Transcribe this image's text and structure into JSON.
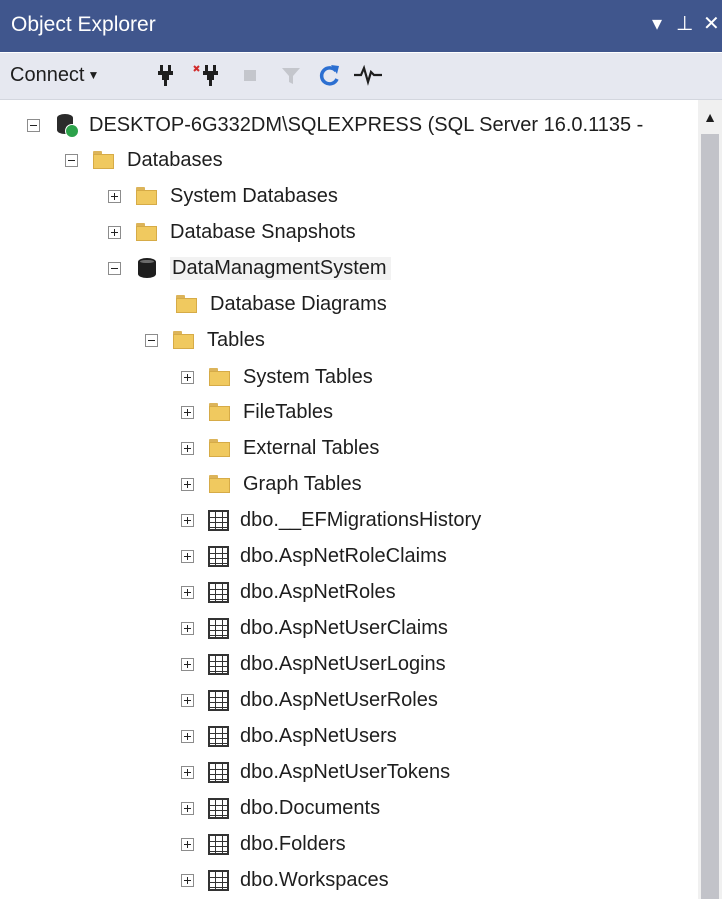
{
  "window": {
    "title": "Object Explorer",
    "controls": {
      "dropdown": "▾",
      "pin": "⊥",
      "close": "✕"
    },
    "colors": {
      "title_bar": "#40568d",
      "toolbar": "#e6e8f0"
    }
  },
  "toolbar": {
    "connect_label": "Connect",
    "icons": [
      "connect-object-explorer-icon",
      "disconnect-icon",
      "stop-icon",
      "filter-icon",
      "refresh-icon",
      "activity-monitor-icon"
    ]
  },
  "tree": {
    "server": {
      "label": "DESKTOP-6G332DM\\SQLEXPRESS (SQL Server 16.0.1135 -"
    },
    "databases": {
      "label": "Databases"
    },
    "system_databases": {
      "label": "System Databases"
    },
    "database_snapshots": {
      "label": "Database Snapshots"
    },
    "database": {
      "label": "DataManagmentSystem"
    },
    "database_diagrams": {
      "label": "Database Diagrams"
    },
    "tables": {
      "label": "Tables"
    },
    "system_tables": {
      "label": "System Tables"
    },
    "file_tables": {
      "label": "FileTables"
    },
    "external_tables": {
      "label": "External Tables"
    },
    "graph_tables": {
      "label": "Graph Tables"
    },
    "table_items": [
      "dbo.__EFMigrationsHistory",
      "dbo.AspNetRoleClaims",
      "dbo.AspNetRoles",
      "dbo.AspNetUserClaims",
      "dbo.AspNetUserLogins",
      "dbo.AspNetUserRoles",
      "dbo.AspNetUsers",
      "dbo.AspNetUserTokens",
      "dbo.Documents",
      "dbo.Folders",
      "dbo.Workspaces"
    ]
  }
}
